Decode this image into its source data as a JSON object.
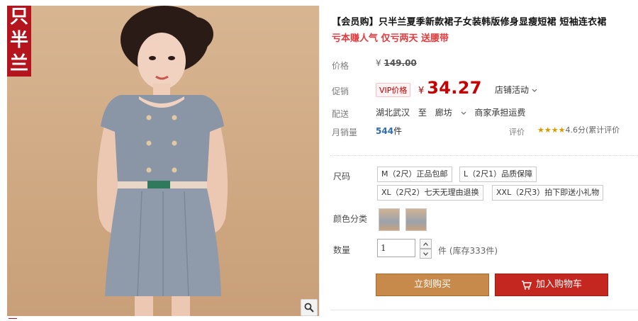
{
  "image": {
    "brand_chars": [
      "只",
      "半",
      "兰"
    ]
  },
  "product": {
    "title": "【会员购】只半兰夏季新款裙子女装韩版修身显瘦短裙 短袖连衣裙",
    "subtitle": "亏本赚人气 仅亏两天 送腰带"
  },
  "price": {
    "label": "价格",
    "currency": "¥",
    "original": "149.00",
    "promo_label": "促销",
    "vip_badge": "VIP价格",
    "vip_currency": "¥",
    "vip_value": "34.27",
    "store_activity": "店铺活动"
  },
  "shipping": {
    "label": "配送",
    "from": "湖北武汉",
    "to_word": "至",
    "destination": "廊坊",
    "fee": "商家承担运费"
  },
  "sales": {
    "label": "月销量",
    "count": "544",
    "unit": "件",
    "rating_label": "评价",
    "stars": "★★★★",
    "rating_text": "4.6分(累计评价"
  },
  "sku": {
    "size_label": "尺码",
    "sizes": [
      "M（2尺）正品包邮",
      "L（2尺1）品质保障",
      "XL（2尺2）七天无理由退换",
      "XXL（2尺3）拍下即送小礼物"
    ],
    "color_label": "颜色分类",
    "qty_label": "数量",
    "qty_value": "1",
    "qty_unit": "件",
    "stock_text": "(库存333件)"
  },
  "actions": {
    "buy_now": "立刻购买",
    "add_to_cart": "加入购物车"
  },
  "colors": {
    "accent_red": "#c40000",
    "buy_button": "#c88a4a",
    "cart_button": "#c4271f",
    "brand_block": "#b4141e"
  },
  "icons": {
    "zoom": "magnifier-icon",
    "cart": "cart-icon",
    "dropdown": "chevron-down-icon"
  }
}
